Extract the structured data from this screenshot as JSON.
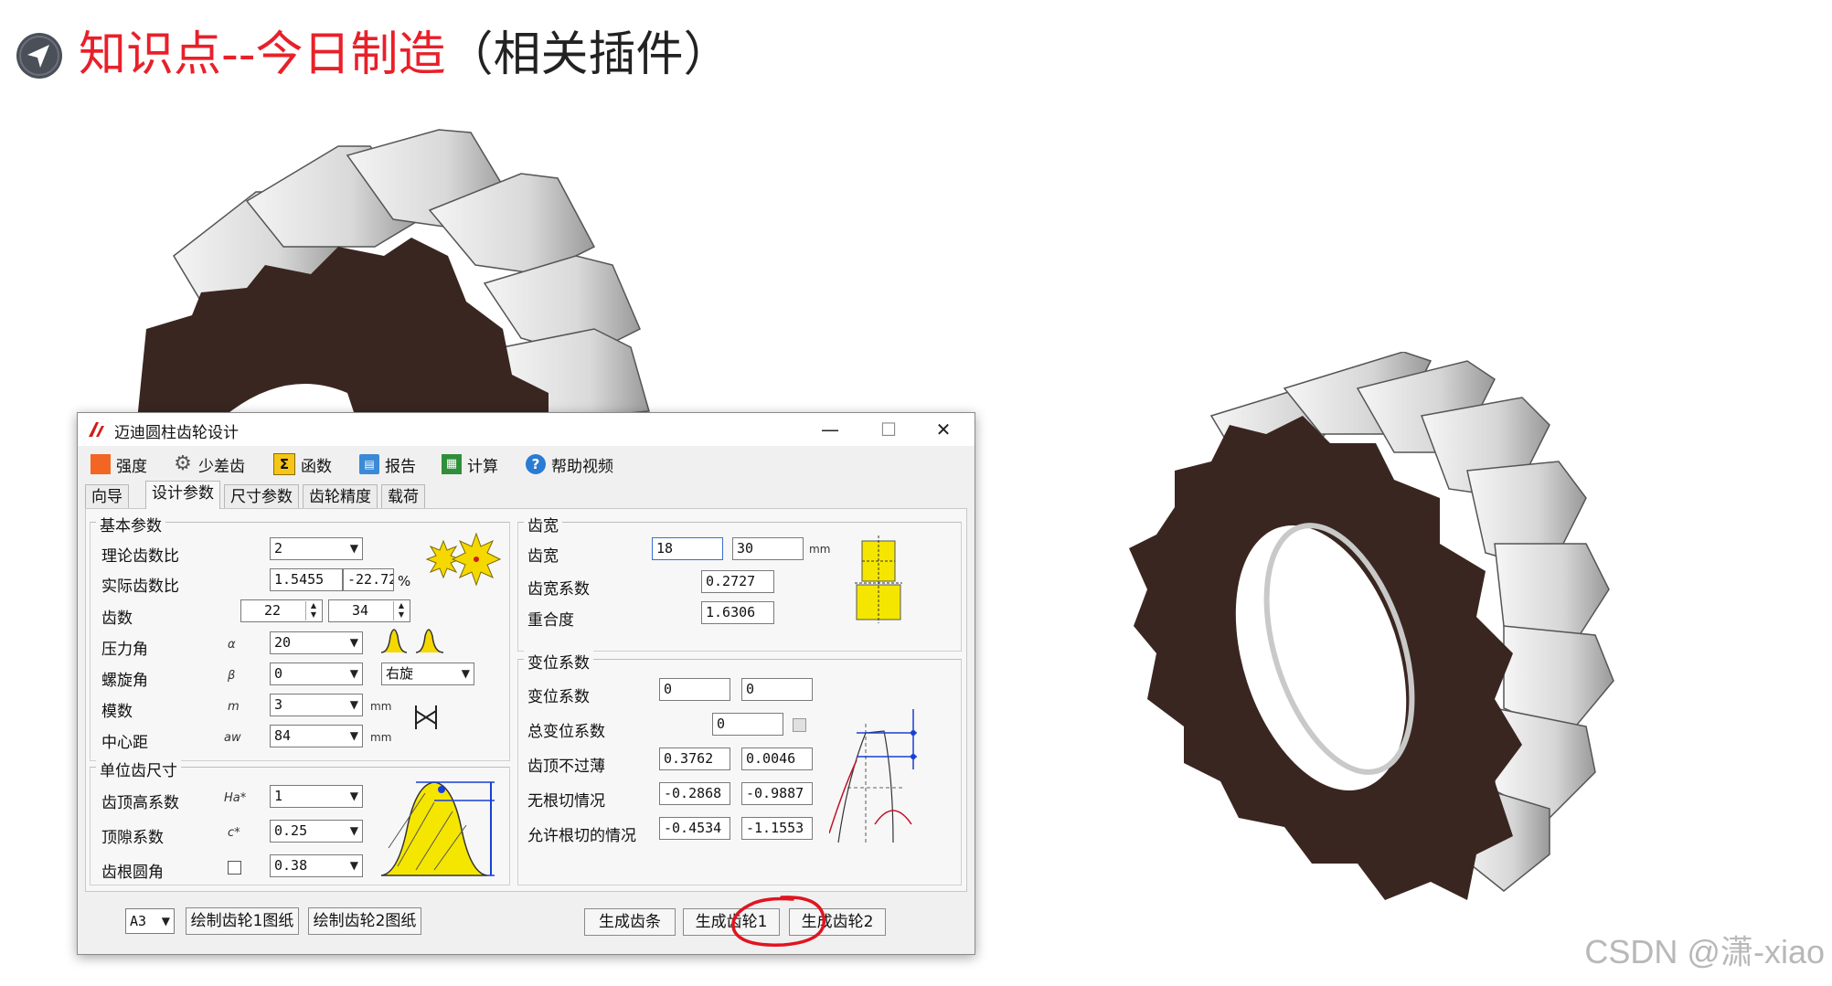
{
  "slide": {
    "title_main": "知识点--今日制造",
    "title_sub": "（相关插件）"
  },
  "watermark": "CSDN @潇-xiao",
  "colors": {
    "title_red": "#e8202a",
    "gear_dark": "#3a2620",
    "highlight_red": "#e0151f"
  },
  "dialog": {
    "title": "迈迪圆柱齿轮设计",
    "window_controls": {
      "minimize": "—",
      "maximize": "☐",
      "close": "✕"
    },
    "toolbar": [
      {
        "label": "强度",
        "icon": "orange-square-icon"
      },
      {
        "label": "少差齿",
        "icon": "gear-icon"
      },
      {
        "label": "函数",
        "icon": "sigma-icon"
      },
      {
        "label": "报告",
        "icon": "report-icon"
      },
      {
        "label": "计算",
        "icon": "calculator-icon"
      },
      {
        "label": "帮助视频",
        "icon": "help-icon"
      }
    ],
    "tabs": [
      "向导",
      "设计参数",
      "尺寸参数",
      "齿轮精度",
      "载荷"
    ],
    "active_tab": "设计参数",
    "basic": {
      "group_title": "基本参数",
      "theory_ratio": {
        "label": "理论齿数比",
        "value": "2"
      },
      "actual_ratio": {
        "label": "实际齿数比",
        "value": "1.5455",
        "deviation": "-22.72",
        "unit": "%"
      },
      "teeth": {
        "label": "齿数",
        "z1": "22",
        "z2": "34"
      },
      "pressure_angle": {
        "label": "压力角",
        "symbol": "α",
        "value": "20"
      },
      "helix_angle": {
        "label": "螺旋角",
        "symbol": "β",
        "value": "0",
        "direction": "右旋"
      },
      "module": {
        "label": "模数",
        "symbol": "m",
        "value": "3",
        "unit": "mm"
      },
      "center_distance": {
        "label": "中心距",
        "symbol": "aw",
        "value": "84",
        "unit": "mm"
      }
    },
    "unit_tooth": {
      "group_title": "单位齿尺寸",
      "addendum": {
        "label": "齿顶高系数",
        "symbol": "Ha*",
        "value": "1"
      },
      "clearance": {
        "label": "顶隙系数",
        "symbol": "c*",
        "value": "0.25"
      },
      "root_fillet": {
        "label": "齿根圆角",
        "value": "0.38"
      }
    },
    "face_width": {
      "group_title": "齿宽",
      "width": {
        "label": "齿宽",
        "b1": "18",
        "b2": "30",
        "unit": "mm"
      },
      "coefficient": {
        "label": "齿宽系数",
        "value": "0.2727"
      },
      "overlap": {
        "label": "重合度",
        "value": "1.6306"
      }
    },
    "shift": {
      "group_title": "变位系数",
      "shift_coef": {
        "label": "变位系数",
        "x1": "0",
        "x2": "0"
      },
      "total_shift": {
        "label": "总变位系数",
        "value": "0"
      },
      "tip_not_thin": {
        "label": "齿顶不过薄",
        "v1": "0.3762",
        "v2": "0.0046"
      },
      "no_undercut": {
        "label": "无根切情况",
        "v1": "-0.2868",
        "v2": "-0.9887"
      },
      "allow_undercut": {
        "label": "允许根切的情况",
        "v1": "-0.4534",
        "v2": "-1.1553"
      }
    },
    "bottom": {
      "paper_size": "A3",
      "draw_gear1": "绘制齿轮1图纸",
      "draw_gear2": "绘制齿轮2图纸",
      "gen_rack": "生成齿条",
      "gen_gear1": "生成齿轮1",
      "gen_gear2": "生成齿轮2"
    }
  }
}
